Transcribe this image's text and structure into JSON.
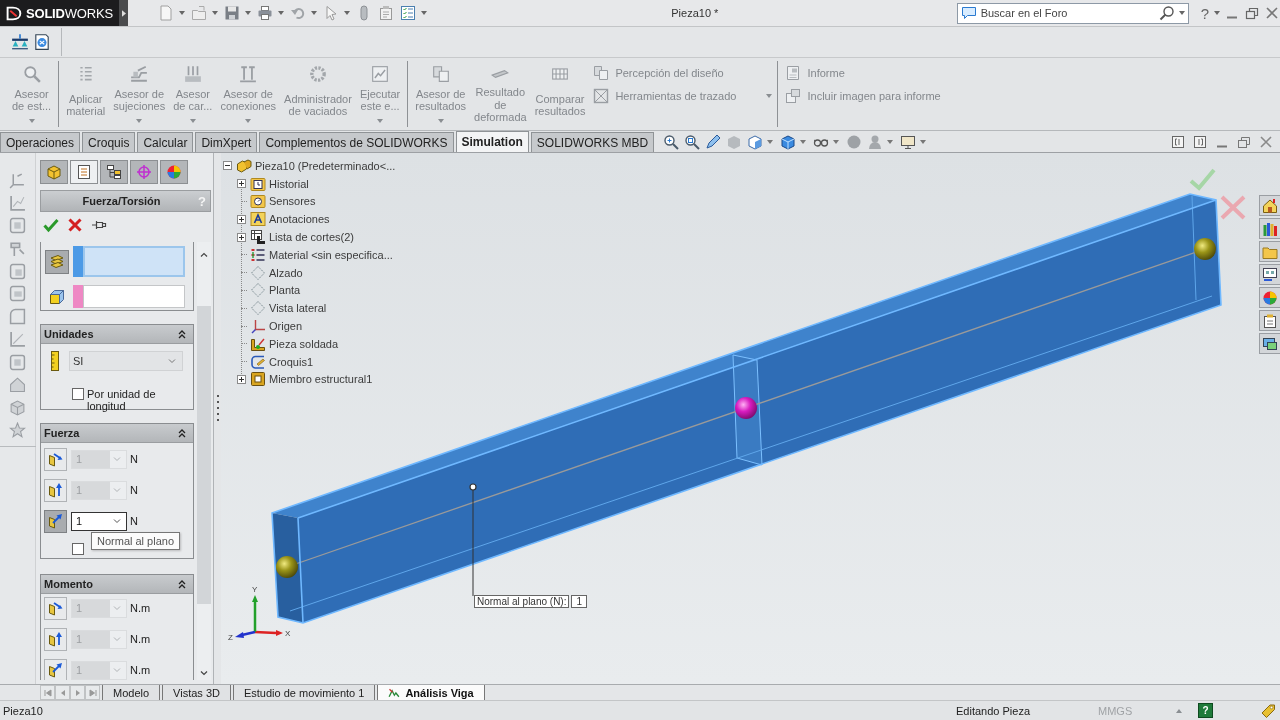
{
  "title_bar": {
    "logo": "**SOLID**WORKS",
    "title": "Pieza10 *",
    "search": {
      "placeholder": "Buscar en el Foro"
    },
    "help": "?"
  },
  "ribbon": {
    "groups": [
      {
        "items": [
          {
            "label": "Asesor\nde est...",
            "kind": "large",
            "dropdown": true,
            "disabled": true
          }
        ]
      },
      {
        "items": [
          {
            "label": "Aplicar\nmaterial",
            "kind": "large",
            "dropdown": false,
            "disabled": true
          },
          {
            "label": "Asesor de\nsujeciones",
            "kind": "large",
            "dropdown": true,
            "disabled": true
          },
          {
            "label": "Asesor\nde car...",
            "kind": "large",
            "dropdown": true,
            "disabled": true
          },
          {
            "label": "Asesor de\nconexiones",
            "kind": "large",
            "dropdown": true,
            "disabled": true
          },
          {
            "label": "Administrador\nde vaciados",
            "kind": "large",
            "dropdown": false,
            "disabled": true
          },
          {
            "label": "Ejecutar\neste e...",
            "kind": "large",
            "dropdown": true,
            "disabled": true
          }
        ]
      },
      {
        "items": [
          {
            "label": "Asesor de\nresultados",
            "kind": "large",
            "dropdown": true,
            "disabled": true
          },
          {
            "label": "Resultado\nde\ndeformada",
            "kind": "large",
            "dropdown": false,
            "disabled": true
          },
          {
            "label": "Comparar\nresultados",
            "kind": "large",
            "dropdown": false,
            "disabled": true
          },
          {
            "label": "Percepción del diseño",
            "kind": "small",
            "dropdown": false,
            "disabled": true
          },
          {
            "label": "Herramientas de trazado",
            "kind": "small",
            "dropdown": true,
            "disabled": true
          }
        ]
      },
      {
        "items": [
          {
            "label": "Informe",
            "kind": "small",
            "dropdown": false,
            "disabled": true
          },
          {
            "label": "Incluir imagen para informe",
            "kind": "small",
            "dropdown": false,
            "disabled": true
          }
        ]
      }
    ]
  },
  "command_tabs": [
    {
      "label": "Operaciones",
      "selected": false
    },
    {
      "label": "Croquis",
      "selected": false
    },
    {
      "label": "Calcular",
      "selected": false
    },
    {
      "label": "DimXpert",
      "selected": false
    },
    {
      "label": "Complementos de SOLIDWORKS",
      "selected": false
    },
    {
      "label": "Simulation",
      "selected": true
    },
    {
      "label": "SOLIDWORKS MBD",
      "selected": false
    }
  ],
  "property_manager": {
    "tabs": [
      {
        "selected": false
      },
      {
        "selected": true
      },
      {
        "selected": false
      },
      {
        "selected": false
      },
      {
        "selected": false
      }
    ],
    "title": "Fuerza/Torsión",
    "help": "?",
    "selection_lists": [
      {
        "color": "#4c9ae6",
        "selected": true
      },
      {
        "color": "#ee88c4",
        "selected": false
      }
    ],
    "sections": [
      {
        "kind": "units",
        "title": "Unidades",
        "expanded": true,
        "unit_system": "SI",
        "checkbox": {
          "label": "Por unidad de longitud",
          "checked": false
        }
      },
      {
        "kind": "components",
        "title": "Fuerza",
        "expanded": true,
        "rows": [
          {
            "value": "1",
            "unit": "N",
            "disabled": true,
            "selected": false
          },
          {
            "value": "1",
            "unit": "N",
            "disabled": true,
            "selected": false
          },
          {
            "value": "1",
            "unit": "N",
            "disabled": false,
            "selected": true
          }
        ],
        "checkbox": {
          "checked": false
        }
      },
      {
        "kind": "components",
        "title": "Momento",
        "expanded": true,
        "rows": [
          {
            "value": "1",
            "unit": "N.m",
            "disabled": true,
            "selected": false
          },
          {
            "value": "1",
            "unit": "N.m",
            "disabled": true,
            "selected": false
          },
          {
            "value": "1",
            "unit": "N.m",
            "disabled": true,
            "selected": false
          }
        ]
      }
    ],
    "tooltip": "Normal al plano"
  },
  "feature_tree": [
    {
      "label": "Pieza10  (Predeterminado<...",
      "kind": "part",
      "expandable": true,
      "expanded": true,
      "children": [
        {
          "label": "Historial",
          "kind": "history",
          "expandable": true,
          "expanded": false
        },
        {
          "label": "Sensores",
          "kind": "sensors",
          "expandable": false,
          "expanded": false
        },
        {
          "label": "Anotaciones",
          "kind": "annotations",
          "expandable": true,
          "expanded": false
        },
        {
          "label": "Lista de cortes(2)",
          "kind": "cut-list",
          "expandable": true,
          "expanded": false
        },
        {
          "label": "Material <sin especifica...",
          "kind": "material",
          "expandable": false,
          "expanded": false
        },
        {
          "label": "Alzado",
          "kind": "plane",
          "expandable": false,
          "expanded": false
        },
        {
          "label": "Planta",
          "kind": "plane",
          "expandable": false,
          "expanded": false
        },
        {
          "label": "Vista lateral",
          "kind": "plane",
          "expandable": false,
          "expanded": false
        },
        {
          "label": "Origen",
          "kind": "origin",
          "expandable": false,
          "expanded": false
        },
        {
          "label": "Pieza soldada",
          "kind": "weldment",
          "expandable": false,
          "expanded": false
        },
        {
          "label": "Croquis1",
          "kind": "sketch",
          "expandable": false,
          "expanded": false
        },
        {
          "label": "Miembro estructural1",
          "kind": "structural-member",
          "expandable": true,
          "expanded": false
        }
      ]
    }
  ],
  "viewport": {
    "callout": {
      "label": "Normal al plano (N):",
      "value": "1"
    },
    "triad": [
      {
        "label": "X",
        "color": "#dd2222"
      },
      {
        "label": "Y",
        "color": "#22a02a"
      },
      {
        "label": "Z",
        "color": "#2233cc"
      }
    ]
  },
  "sheet_tabs": [
    {
      "label": "Modelo",
      "kind": "sheet",
      "selected": false
    },
    {
      "label": "Vistas 3D",
      "kind": "sheet",
      "selected": false
    },
    {
      "label": "Estudio de movimiento 1",
      "kind": "sheet",
      "selected": false
    },
    {
      "label": "Análisis Viga",
      "kind": "study",
      "selected": true
    }
  ],
  "status_bar": {
    "document": "Pieza10",
    "mode": "Editando Pieza",
    "units": {
      "label": "MMGS",
      "disabled": true
    },
    "help": "?"
  }
}
